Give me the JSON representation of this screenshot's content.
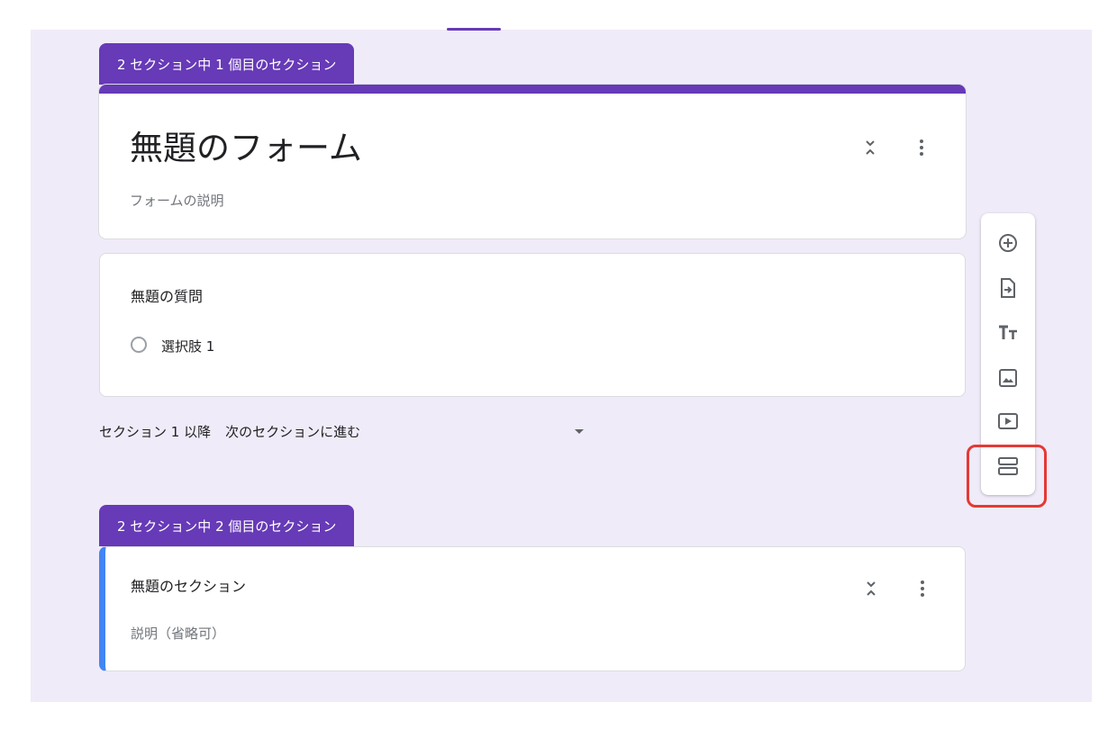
{
  "section1": {
    "tab_label": "2 セクション中 1 個目のセクション",
    "form_title": "無題のフォーム",
    "form_description": "フォームの説明"
  },
  "question": {
    "title": "無題の質問",
    "option_label": "選択肢 1"
  },
  "after_section": {
    "label": "セクション 1 以降",
    "value": "次のセクションに進む"
  },
  "section2": {
    "tab_label": "2 セクション中 2 個目のセクション",
    "title": "無題のセクション",
    "description": "説明（省略可）"
  },
  "toolbar": {
    "items": [
      "add-question-icon",
      "import-questions-icon",
      "add-title-icon",
      "add-image-icon",
      "add-video-icon",
      "add-section-icon"
    ]
  },
  "colors": {
    "accent": "#673ab7",
    "background": "#f0ebf8",
    "section_border": "#4285f4",
    "highlight": "#e53935"
  }
}
